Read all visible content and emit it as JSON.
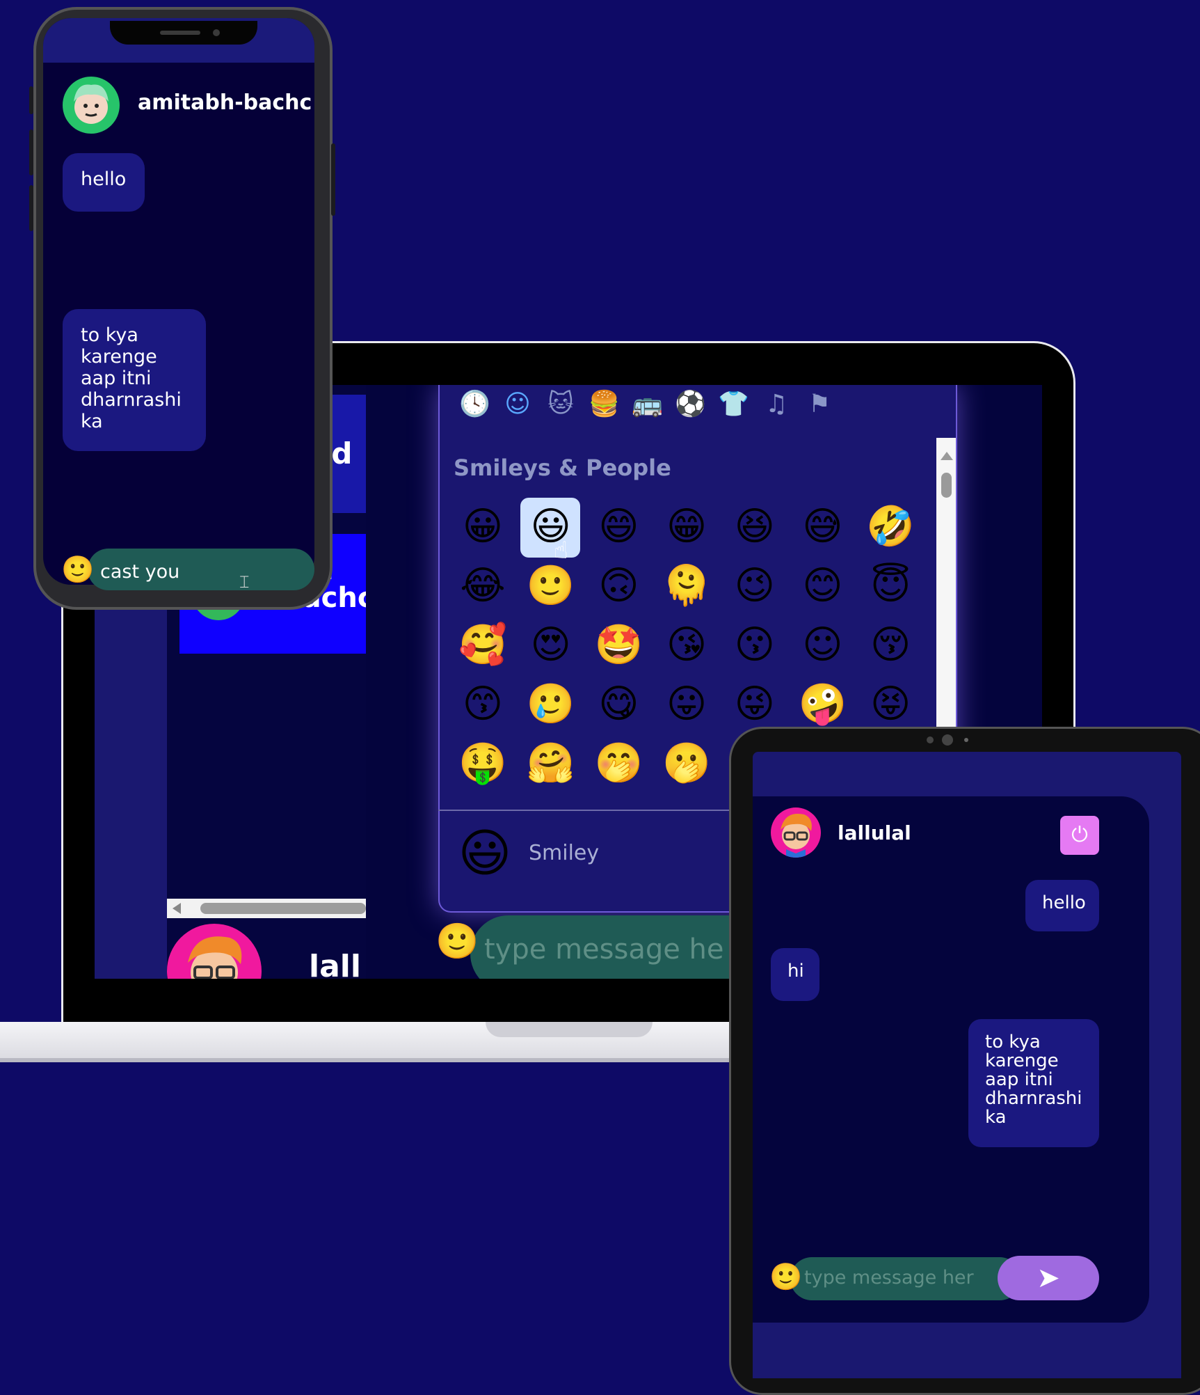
{
  "laptop": {
    "sidebar_top_text": "ned",
    "active_contact_name": "ital bachcl",
    "contact2_name": "lall",
    "emoji_categories": [
      {
        "name": "recent",
        "glyph": "🕓"
      },
      {
        "name": "smileys",
        "glyph": "☺"
      },
      {
        "name": "animals",
        "glyph": "🐱"
      },
      {
        "name": "food",
        "glyph": "🍔"
      },
      {
        "name": "travel",
        "glyph": "🚌"
      },
      {
        "name": "activities",
        "glyph": "⚽"
      },
      {
        "name": "objects",
        "glyph": "👕"
      },
      {
        "name": "symbols",
        "glyph": "♫"
      },
      {
        "name": "flags",
        "glyph": "⚑"
      }
    ],
    "emoji_section_title": "Smileys & People",
    "emoji_grid": [
      [
        "😀",
        "😃",
        "😄",
        "😁",
        "😆",
        "😅",
        "🤣"
      ],
      [
        "😂",
        "🙂",
        "🙃",
        "🫠",
        "😉",
        "😊",
        "😇"
      ],
      [
        "🥰",
        "😍",
        "🤩",
        "😘",
        "😗",
        "☺",
        "😚"
      ],
      [
        "😙",
        "🥲",
        "😋",
        "😛",
        "😜",
        "🤪",
        "😝"
      ],
      [
        "🤑",
        "🤗",
        "🤭",
        "🫢"
      ]
    ],
    "emoji_hovered": "😃",
    "preview_emoji": "😃",
    "preview_label": "Smiley",
    "input_placeholder": "type message he"
  },
  "phone": {
    "username": "amitabh-bachcha",
    "messages": [
      "hello",
      "to kya karenge aap itni dharnrashi ka"
    ],
    "input_value": "cast you",
    "input_emoji": "🙂"
  },
  "tablet": {
    "username": "lallulal",
    "power_icon": "⏻",
    "messages": [
      "hello",
      "hi",
      "to kya karenge aap itni dharnrashi ka"
    ],
    "input_placeholder": "type message her",
    "input_emoji": "🙂",
    "send_icon": "➤"
  },
  "colors": {
    "background": "#0e0a66",
    "bubble": "#1b1880",
    "input": "#1f5b55",
    "send": "#9f6ae0",
    "power": "#e57af3"
  }
}
